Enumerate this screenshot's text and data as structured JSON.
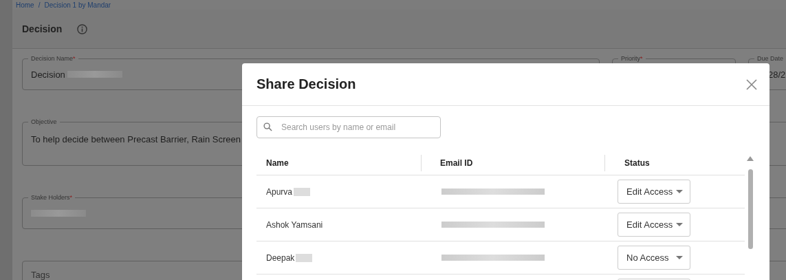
{
  "breadcrumb": {
    "items": [
      "Home",
      "Decision 1 by Mandar"
    ],
    "separator": "/"
  },
  "page_title": "Decision",
  "field_rows": [
    [
      {
        "label": "Decision Name",
        "required_mark": "*",
        "value": "Decision",
        "redacted": true
      },
      {
        "label": "Priority",
        "required_mark": "*"
      },
      {
        "label": "Due Date",
        "value": "28/2"
      }
    ],
    [
      {
        "label": "Objective",
        "value": "To help decide between Precast Barrier, Rain Screen",
        "kind": "textarea"
      }
    ],
    [
      {
        "label": "Stake Holders",
        "required_mark": "*",
        "redacted": true
      }
    ],
    [
      {
        "label": "Tags",
        "kind": "empty"
      }
    ]
  ],
  "dialog": {
    "title": "Share Decision",
    "search": {
      "placeholder": "Search users by name or email"
    },
    "table": {
      "columns": [
        "Name",
        "Email ID",
        "Status"
      ],
      "rows": [
        {
          "name": "Apurva",
          "name_redacted": true,
          "email_redacted": true,
          "status": "Edit Access"
        },
        {
          "name": "Ashok Yamsani",
          "name_redacted": false,
          "email_redacted": true,
          "status": "Edit Access"
        },
        {
          "name": "Deepak",
          "name_redacted": true,
          "email_redacted": true,
          "status": "No Access"
        }
      ]
    }
  }
}
